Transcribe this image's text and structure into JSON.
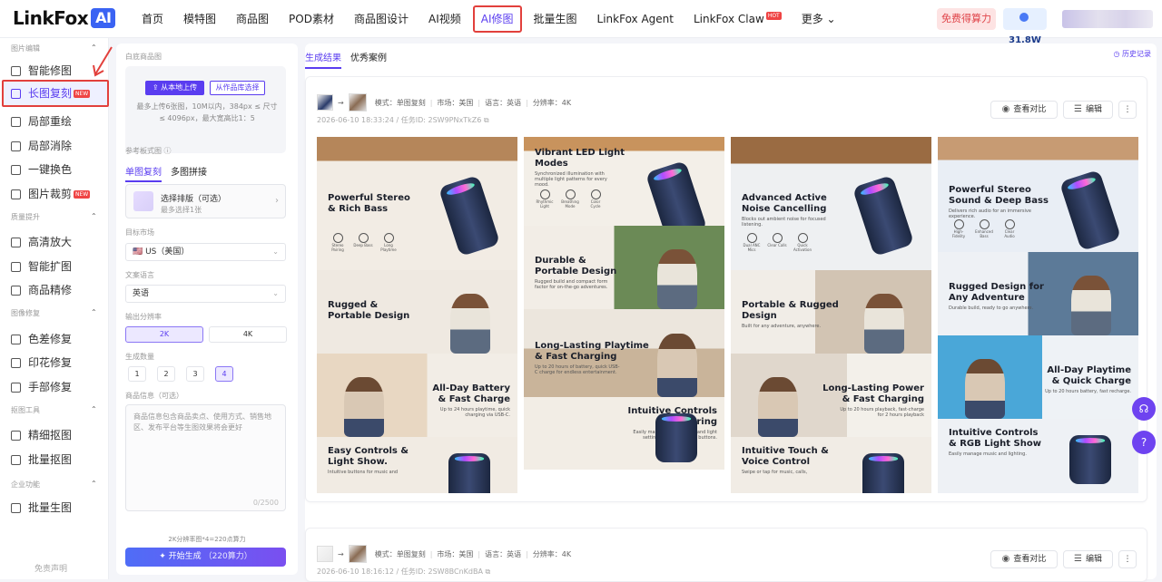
{
  "nav": {
    "logo_text": "LinkFox",
    "logo_ai": "AI",
    "items": [
      {
        "label": "首页"
      },
      {
        "label": "模特图"
      },
      {
        "label": "商品图"
      },
      {
        "label": "POD素材"
      },
      {
        "label": "商品图设计"
      },
      {
        "label": "AI视频"
      },
      {
        "label": "AI修图"
      },
      {
        "label": "批量生图"
      },
      {
        "label": "LinkFox Agent"
      },
      {
        "label": "LinkFox Claw",
        "badge": "HOT"
      },
      {
        "label": "更多 ⌄"
      }
    ],
    "active_index": 6,
    "free_credits_button": "免费得算力",
    "credits_value": "31.8W"
  },
  "sidebar": {
    "sections": [
      {
        "title": "图片编辑",
        "items": [
          {
            "label": "智能修图",
            "icon": "magic-icon"
          },
          {
            "label": "长图复刻",
            "icon": "document-icon",
            "badge": "NEW",
            "active": true
          },
          {
            "label": "局部重绘",
            "icon": "brush-icon"
          },
          {
            "label": "局部消除",
            "icon": "eraser-icon"
          },
          {
            "label": "一键换色",
            "icon": "palette-icon"
          },
          {
            "label": "图片裁剪",
            "icon": "crop-icon",
            "badge": "NEW"
          }
        ]
      },
      {
        "title": "质量提升",
        "items": [
          {
            "label": "高清放大",
            "icon": "expand-icon"
          },
          {
            "label": "智能扩图",
            "icon": "extend-icon"
          },
          {
            "label": "商品精修",
            "icon": "refine-icon"
          }
        ]
      },
      {
        "title": "图像修复",
        "items": [
          {
            "label": "色差修复",
            "icon": "color-fix-icon"
          },
          {
            "label": "印花修复",
            "icon": "print-fix-icon"
          },
          {
            "label": "手部修复",
            "icon": "hand-icon"
          }
        ]
      },
      {
        "title": "抠图工具",
        "items": [
          {
            "label": "精细抠图",
            "icon": "cutout-icon"
          },
          {
            "label": "批量抠图",
            "icon": "batch-cutout-icon"
          }
        ]
      },
      {
        "title": "企业功能",
        "items": [
          {
            "label": "批量生图",
            "icon": "batch-icon"
          }
        ]
      }
    ],
    "footer": "免责声明"
  },
  "panel": {
    "upload_label": "白底商品图",
    "upload_local": "从本地上传",
    "upload_library": "从作品库选择",
    "upload_hint": "最多上传6张图，10M以内，384px ≤ 尺寸 ≤ 4096px，最大宽高比1：5",
    "ref_label": "参考板式图",
    "tabs": [
      "单图复刻",
      "多图拼接"
    ],
    "layout_title": "选择排版（可选）",
    "layout_sub": "最多选择1张",
    "market_label": "目标市场",
    "market_value": "🇺🇸 US（美国）",
    "lang_label": "文案语言",
    "lang_value": "英语",
    "res_label": "输出分辨率",
    "res_options": [
      "2K",
      "4K"
    ],
    "res_selected": "2K",
    "count_label": "生成数量",
    "count_options": [
      "1",
      "2",
      "3",
      "4"
    ],
    "count_selected": "4",
    "info_label": "商品信息（可选）",
    "info_placeholder": "商品信息包含商品卖点、使用方式、销售地区、发布平台等生图效果将会更好",
    "info_counter": "0/2500",
    "gen_note": "2K分辨率图*4=220点算力",
    "gen_button": "开始生成",
    "gen_cost": "（220算力）"
  },
  "main": {
    "tabs": [
      "生成结果",
      "优秀案例"
    ],
    "history": "历史记录",
    "cards": [
      {
        "mode": "模式：单图复刻",
        "market": "市场：美国",
        "language": "语言：英语",
        "resolution": "分辨率：4K",
        "time_id": "2026-06-10 18:33:24 / 任务ID: 2SW9PNxTkZ6",
        "compare": "查看对比",
        "edit": "编辑"
      },
      {
        "mode": "模式：单图复刻",
        "market": "市场：美国",
        "language": "语言：英语",
        "resolution": "分辨率：4K",
        "time_id": "2026-06-10 18:16:12 / 任务ID: 2SW8BCnKdBA",
        "compare": "查看对比",
        "edit": "编辑"
      }
    ],
    "columns": [
      [
        {
          "h": "Powerful Stereo\n& Rich Bass",
          "s": "",
          "icons": [
            "Stereo Pairing",
            "Deep Bass",
            "Long Playtime"
          ]
        },
        {
          "h": "Rugged &\nPortable Design",
          "s": ""
        },
        {
          "h": "All-Day Battery\n& Fast Charge",
          "s": "Up to 24 hours playtime, quick charging via USB-C."
        },
        {
          "h": "Easy Controls &\nLight Show.",
          "s": "Intuitive buttons for music and"
        }
      ],
      [
        {
          "h": "Vibrant LED Light\nModes",
          "s": "Synchronized illumination with multiple light patterns for every mood.",
          "icons": [
            "Rhythmic Light",
            "Breathing Mode",
            "Color Cycle"
          ]
        },
        {
          "h": "Durable &\nPortable Design",
          "s": "Rugged build and compact form factor for on-the-go adventures."
        },
        {
          "h": "Long-Lasting Playtime\n& Fast Charging",
          "s": "Up to 20 hours of battery, quick USB-C charge for endless entertainment."
        },
        {
          "h": "Intuitive Controls\n& Pairing",
          "s": "Easily manage music, calls, and light settings with accessible buttons."
        }
      ],
      [
        {
          "h": "Advanced Active\nNoise Cancelling",
          "s": "Blocks out ambient noise for focused listening.",
          "icons": [
            "Dual ANC Mics",
            "Clear Calls",
            "Quick Activation"
          ]
        },
        {
          "h": "Portable & Rugged\nDesign",
          "s": "Built for any adventure, anywhere."
        },
        {
          "h": "Long-Lasting Power\n& Fast Charging",
          "s": "Up to 20 hours playback, fast-charge for 2 hours playback"
        },
        {
          "h": "Intuitive Touch &\nVoice Control",
          "s": "Swipe or tap for music, calls,"
        }
      ],
      [
        {
          "h": "Powerful Stereo\nSound & Deep Bass",
          "s": "Delivers rich audio for an immersive experience.",
          "icons": [
            "High-Fidelity",
            "Enhanced Bass",
            "Clear Audio"
          ]
        },
        {
          "h": "Rugged Design for\nAny Adventure",
          "s": "Durable build, ready to go anywhere."
        },
        {
          "h": "All-Day Playtime\n& Quick Charge",
          "s": "Up to 20 hours battery, fast recharge."
        },
        {
          "h": "Intuitive Controls\n& RGB Light Show",
          "s": "Easily manage music and lighting."
        }
      ]
    ]
  }
}
